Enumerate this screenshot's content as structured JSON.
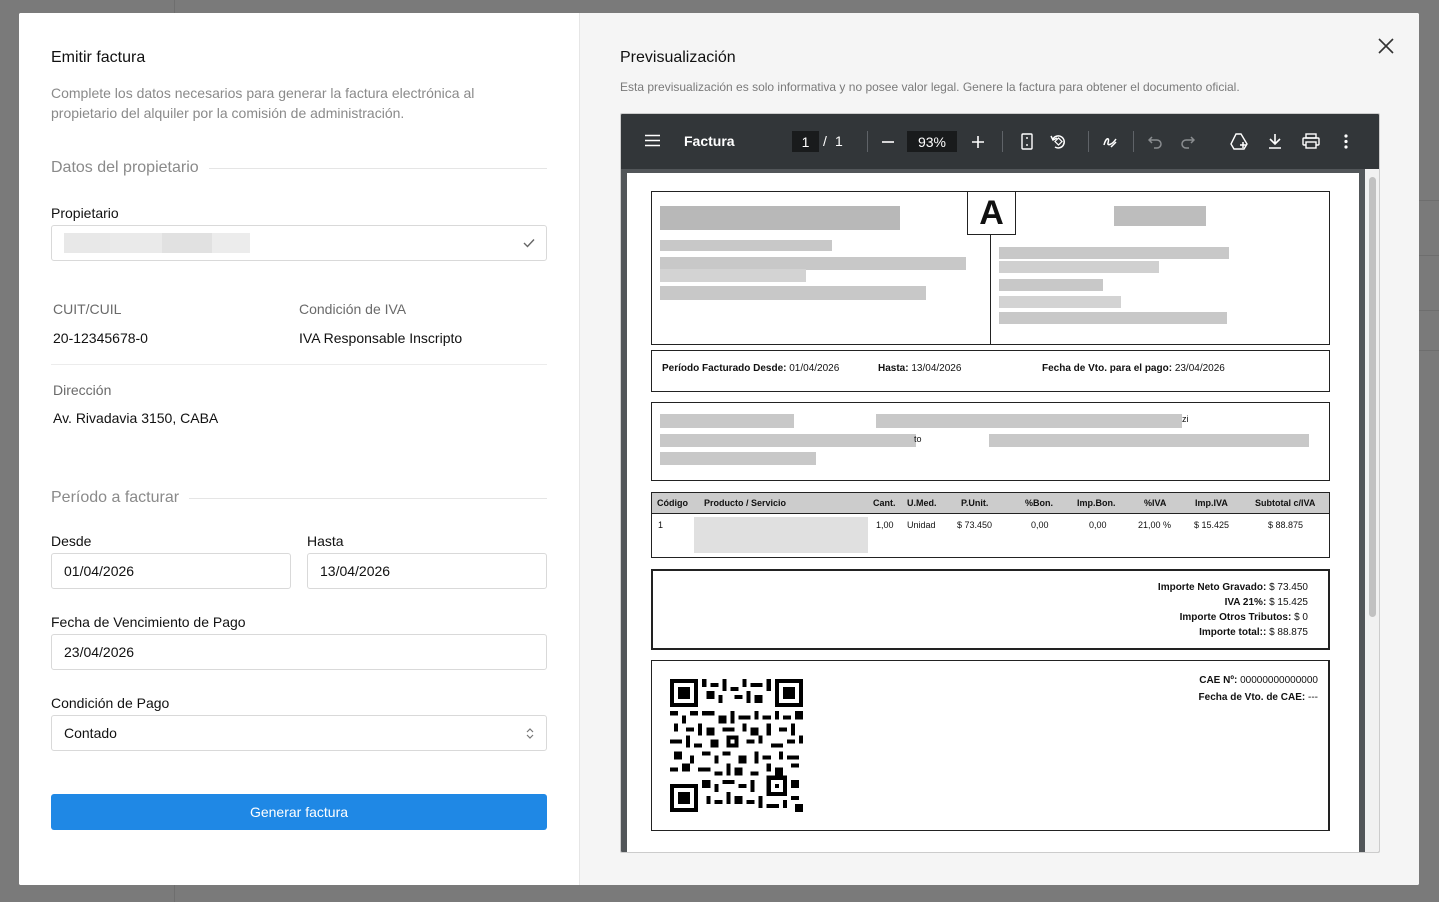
{
  "left": {
    "title": "Emitir factura",
    "description": "Complete los datos necesarios para generar la factura electrónica al propietario del alquiler por la comisión de administración.",
    "section_owner": "Datos del propietario",
    "owner_label": "Propietario",
    "cuit_label": "CUIT/CUIL",
    "cuit_value": "20-12345678-0",
    "iva_label": "Condición de IVA",
    "iva_value": "IVA Responsable Inscripto",
    "address_label": "Dirección",
    "address_value": "Av. Rivadavia 3150, CABA",
    "section_period": "Período a facturar",
    "from_label": "Desde",
    "from_value": "01/04/2026",
    "to_label": "Hasta",
    "to_value": "13/04/2026",
    "due_label": "Fecha de Vencimiento de Pago",
    "due_value": "23/04/2026",
    "payment_label": "Condición de Pago",
    "payment_value": "Contado",
    "submit_label": "Generar factura"
  },
  "right": {
    "title": "Previsualización",
    "description": "Esta previsualización es solo informativa y no posee valor legal. Genere la factura para obtener el documento oficial.",
    "viewer": {
      "doc_title": "Factura",
      "page_current": "1",
      "page_sep": "/",
      "page_total": "1",
      "zoom": "93%"
    },
    "invoice": {
      "letter": "A",
      "period_from_label": "Período Facturado Desde:",
      "period_from": "01/04/2026",
      "period_to_label": "Hasta:",
      "period_to": "13/04/2026",
      "due_label": "Fecha de Vto. para el pago:",
      "due": "23/04/2026",
      "frag_zi": "zi",
      "frag_to": "to",
      "headers": [
        "Código",
        "Producto / Servicio",
        "Cant.",
        "U.Med.",
        "P.Unit.",
        "%Bon.",
        "Imp.Bon.",
        "%IVA",
        "Imp.IVA",
        "Subtotal c/IVA"
      ],
      "row": [
        "1",
        "",
        "1,00",
        "Unidad",
        "$ 73.450",
        "0,00",
        "0,00",
        "21,00 %",
        "$ 15.425",
        "$ 88.875"
      ],
      "neto_label": "Importe Neto Gravado:",
      "neto": "$ 73.450",
      "iva_label": "IVA 21%:",
      "iva": "$ 15.425",
      "otros_label": "Importe Otros Tributos:",
      "otros": "$ 0",
      "total_label": "Importe total::",
      "total": "$ 88.875",
      "cae_label": "CAE Nº:",
      "cae": "00000000000000",
      "cae_vto_label": "Fecha de Vto. de CAE:",
      "cae_vto": "---"
    }
  }
}
